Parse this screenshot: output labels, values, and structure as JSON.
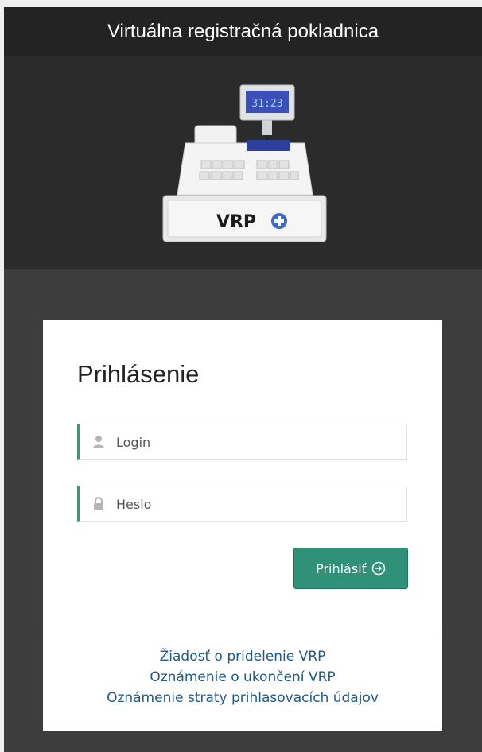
{
  "app": {
    "title": "Virtuálna registračná pokladnica"
  },
  "hero": {
    "register_display": "31:23",
    "logo_text": "VRP",
    "logo_icon": "plus-circle-icon"
  },
  "login_card": {
    "heading": "Prihlásenie",
    "login_field": {
      "placeholder": "Login",
      "value": "",
      "icon": "user-icon"
    },
    "password_field": {
      "placeholder": "Heslo",
      "value": "",
      "icon": "lock-icon"
    },
    "submit_label": "Prihlásiť",
    "submit_icon": "arrow-circle-right-icon"
  },
  "links": [
    "Žiadosť o pridelenie VRP",
    "Oznámenie o ukončení VRP",
    "Oznámenie straty prihlasovacích údajov"
  ],
  "colors": {
    "accent": "#2f9278",
    "field_border_accent": "#2f9e73",
    "link": "#1e5a8a",
    "titlebar_bg": "#232323",
    "hero_bg": "#2b2b2b",
    "page_bg": "#3d3d3d"
  }
}
